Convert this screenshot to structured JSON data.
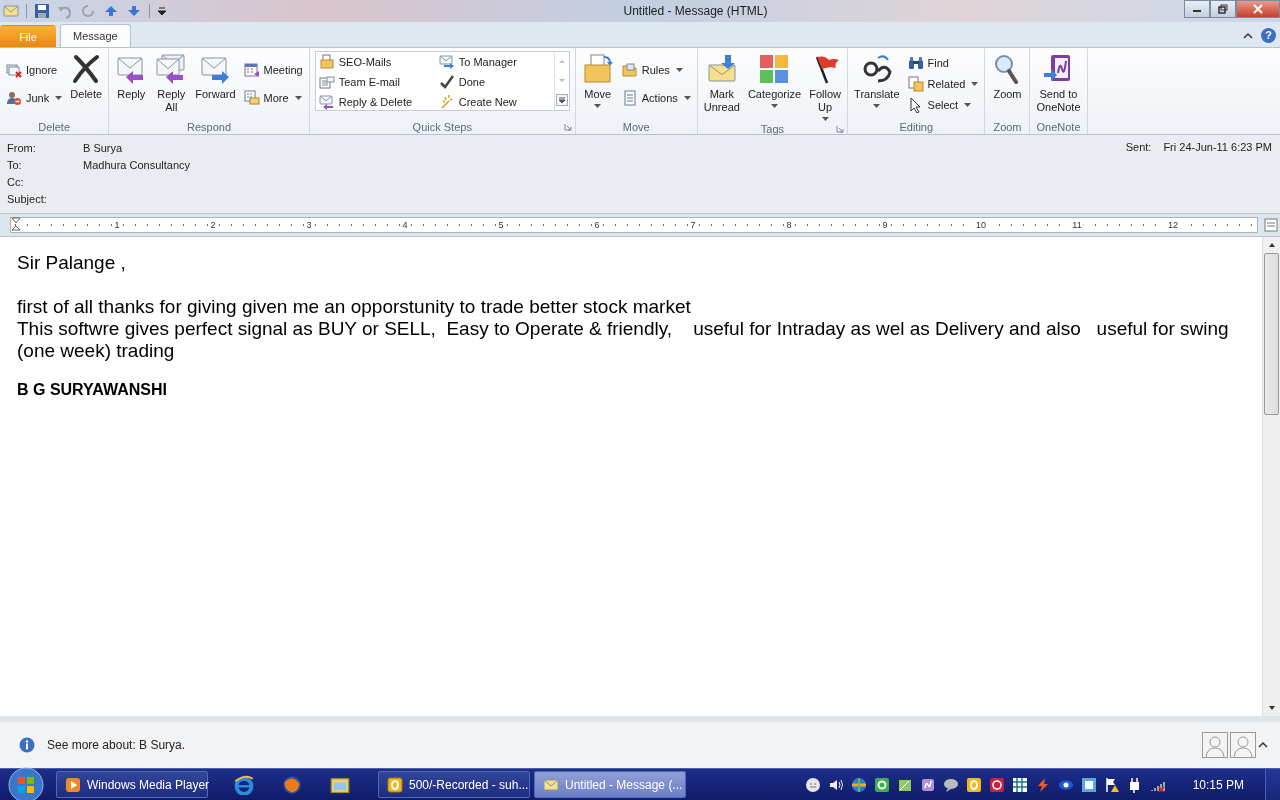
{
  "window": {
    "title": "Untitled - Message (HTML)"
  },
  "tabs": [
    {
      "label": "File",
      "kind": "backstage",
      "selected": false
    },
    {
      "label": "Message",
      "kind": "tab",
      "selected": true
    }
  ],
  "help": "?",
  "ribbon": [
    {
      "label": "Delete",
      "launcher": false,
      "items": [
        {
          "kind": "column",
          "buttons": [
            {
              "label": "Ignore",
              "dropdown": false
            },
            {
              "label": "Junk",
              "dropdown": true
            }
          ]
        },
        {
          "kind": "large",
          "label": "Delete",
          "dropdown": false
        }
      ]
    },
    {
      "label": "Respond",
      "launcher": false,
      "items": [
        {
          "kind": "large",
          "label": "Reply",
          "dropdown": false
        },
        {
          "kind": "large",
          "label": "Reply\nAll",
          "dropdown": false
        },
        {
          "kind": "large",
          "label": "Forward",
          "dropdown": false
        },
        {
          "kind": "column",
          "buttons": [
            {
              "label": "Meeting",
              "dropdown": false
            },
            {
              "label": "More",
              "dropdown": true
            }
          ]
        }
      ]
    },
    {
      "label": "Quick Steps",
      "launcher": true,
      "items": [
        {
          "kind": "gallery",
          "buttons": [
            {
              "label": "SEO-Mails",
              "dropdown": false
            },
            {
              "label": "Team E-mail",
              "dropdown": false
            },
            {
              "label": "Reply & Delete",
              "dropdown": false
            },
            {
              "label": "To Manager",
              "dropdown": false
            },
            {
              "label": "Done",
              "dropdown": false
            },
            {
              "label": "Create New",
              "dropdown": false
            }
          ]
        }
      ]
    },
    {
      "label": "Move",
      "launcher": false,
      "items": [
        {
          "kind": "large",
          "label": "Move",
          "dropdown": true
        },
        {
          "kind": "column",
          "buttons": [
            {
              "label": "Rules",
              "dropdown": true
            },
            {
              "label": "Actions",
              "dropdown": true
            }
          ]
        }
      ]
    },
    {
      "label": "Tags",
      "launcher": true,
      "items": [
        {
          "kind": "large",
          "label": "Mark\nUnread",
          "dropdown": false
        },
        {
          "kind": "large",
          "label": "Categorize",
          "dropdown": true
        },
        {
          "kind": "large",
          "label": "Follow\nUp",
          "dropdown": true
        }
      ]
    },
    {
      "label": "Editing",
      "launcher": false,
      "items": [
        {
          "kind": "large",
          "label": "Translate",
          "dropdown": true
        },
        {
          "kind": "column",
          "buttons": [
            {
              "label": "Find",
              "dropdown": false
            },
            {
              "label": "Related",
              "dropdown": true
            },
            {
              "label": "Select",
              "dropdown": true
            }
          ]
        }
      ]
    },
    {
      "label": "Zoom",
      "launcher": false,
      "items": [
        {
          "kind": "large",
          "label": "Zoom",
          "dropdown": false
        }
      ]
    },
    {
      "label": "OneNote",
      "launcher": false,
      "items": [
        {
          "kind": "large",
          "label": "Send to\nOneNote",
          "dropdown": false
        }
      ]
    }
  ],
  "header": {
    "fields": [
      {
        "label": "From:",
        "value": "B Surya"
      },
      {
        "label": "To:",
        "value": "Madhura Consultancy"
      },
      {
        "label": "Cc:"
      },
      {
        "label": "Subject:"
      }
    ],
    "sent": {
      "label": "Sent:",
      "value": "Fri 24-Jun-11 6:23 PM"
    }
  },
  "ruler": {
    "numbers": [
      "1",
      "2",
      "3",
      "4",
      "5",
      "6",
      "7",
      "8",
      "9",
      "10",
      "11",
      "12"
    ]
  },
  "body": [
    {
      "kind": "greeting",
      "text": "Sir Palange ,"
    },
    {
      "kind": "text",
      "text": "first of all thanks for giving given me an opporstunity to trade better stock market"
    },
    {
      "kind": "text",
      "text": "This softwre gives perfect signal as BUY or SELL,  Easy to Operate & friendly,    useful for Intraday as wel as Delivery and also   useful for swing (one week) trading"
    },
    {
      "kind": "signature",
      "text": "B G SURYAWANSHI"
    }
  ],
  "people_pane": {
    "text": "See more about: B Surya."
  },
  "taskbar": {
    "tasks": [
      {
        "label": "Windows Media Player",
        "selected": false
      },
      {
        "label": "500/-Recorded - suh...",
        "selected": false
      },
      {
        "label": "Untitled - Message (...",
        "selected": true
      }
    ],
    "clock": "10:15 PM"
  }
}
